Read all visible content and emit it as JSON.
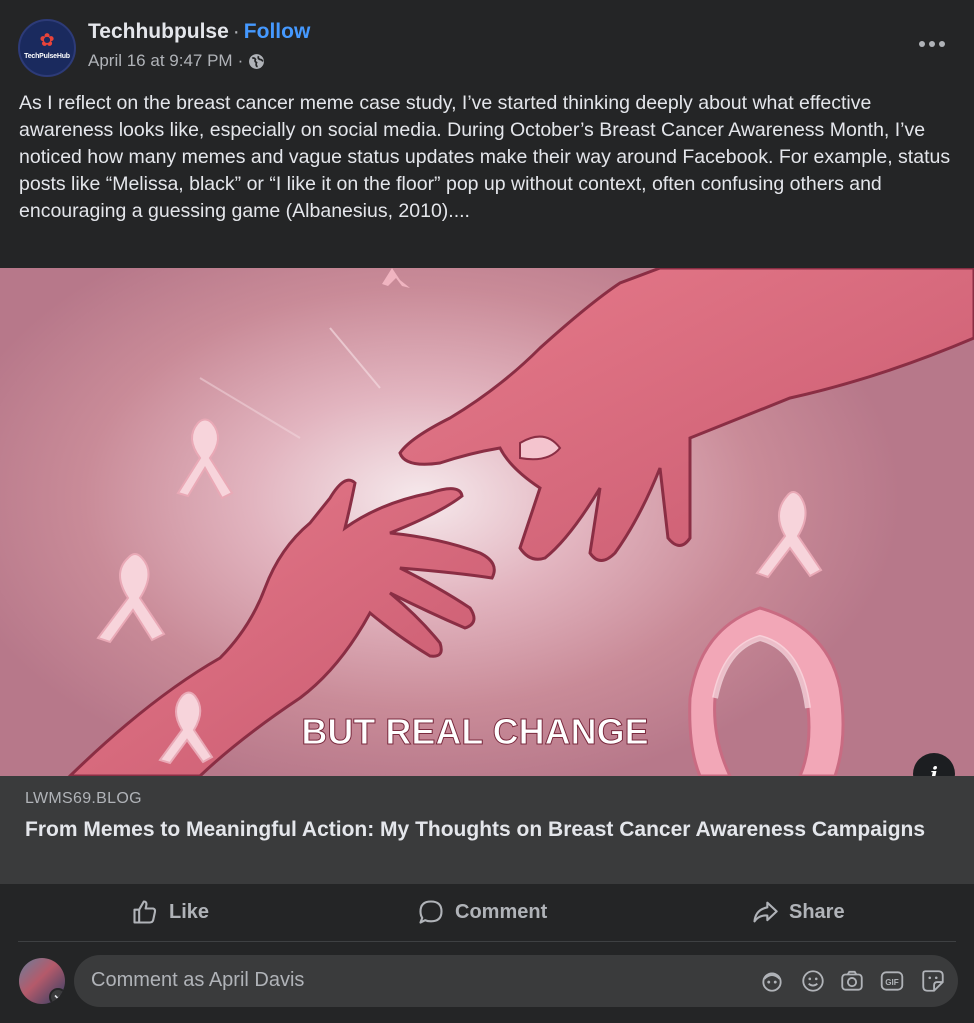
{
  "header": {
    "page_name": "Techhubpulse",
    "separator": "·",
    "follow_label": "Follow",
    "timestamp": "April 16 at 9:47 PM",
    "meta_separator": "·",
    "audience_icon": "globe-icon",
    "avatar_logo_text": "TechPulseHub",
    "more_icon": "more-options-icon"
  },
  "post": {
    "text": "As I reflect on the breast cancer meme case study, I’ve started thinking deeply about what effective awareness looks like, especially on social media. During October’s Breast Cancer Awareness Month, I’ve noticed how many memes and vague status updates make their way around Facebook. For example, status posts like “Melissa, black” or “I like it on the floor” pop up without context, often confusing others and encouraging a guessing game (Albanesius, 2010)...."
  },
  "image": {
    "overlay_text": "BUT REAL CHANGE",
    "info_icon": "info-icon",
    "info_label": "i"
  },
  "link_preview": {
    "domain": "LWMS69.BLOG",
    "title": "From Memes to Meaningful Action: My Thoughts on Breast Cancer Awareness Campaigns"
  },
  "actions": {
    "like_label": "Like",
    "comment_label": "Comment",
    "share_label": "Share"
  },
  "comment": {
    "placeholder": "Comment as April Davis",
    "icons": [
      "avatar-sticker-icon",
      "emoji-icon",
      "camera-icon",
      "gif-icon",
      "sticker-icon"
    ]
  },
  "colors": {
    "background": "#242526",
    "link_box": "#3a3b3c",
    "follow_blue": "#4599ff",
    "primary_text": "#e4e6eb",
    "secondary_text": "#b0b3b8"
  }
}
